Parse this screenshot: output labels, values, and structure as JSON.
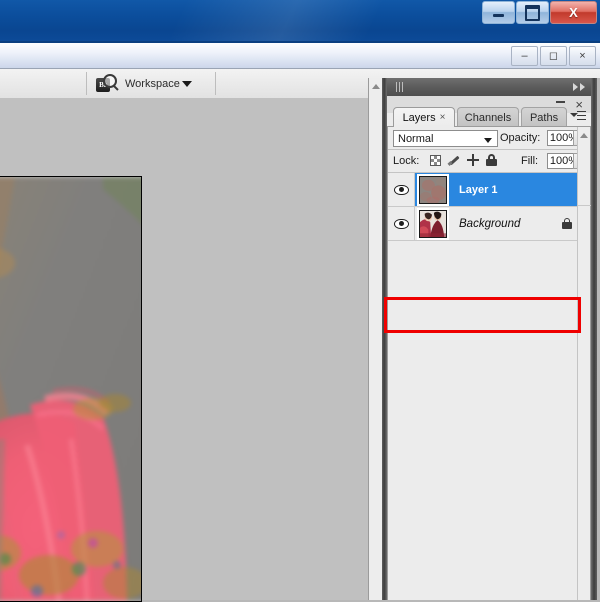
{
  "window": {
    "minimize_label": "–",
    "maximize_label": "❐",
    "close_label": "X"
  },
  "app_window": {
    "minimize_label": "–",
    "restore_label": "❐",
    "close_label": "×"
  },
  "options_bar": {
    "bridge_icon": "bridge-br-icon",
    "bridge_badge_text": "Br",
    "workspace_label": "Workspace",
    "workspace_caret": "chevron-down-icon"
  },
  "dock": {
    "grip": "drag-grip-icon",
    "expand_icon": "double-chevron-right-icon",
    "minimize_label": "–",
    "close_label": "×",
    "panel_menu_icon": "panel-menu-icon"
  },
  "panel": {
    "tabs": [
      {
        "label": "Layers",
        "active": true,
        "closable": true,
        "close_glyph": "×"
      },
      {
        "label": "Channels",
        "active": false,
        "closable": false,
        "close_glyph": ""
      },
      {
        "label": "Paths",
        "active": false,
        "closable": false,
        "close_glyph": ""
      }
    ],
    "blend_mode": {
      "value": "Normal",
      "caret": "chevron-down-icon"
    },
    "opacity": {
      "label": "Opacity:",
      "value": "100%",
      "spinner": "spinner-arrow-icon"
    },
    "fill": {
      "label": "Fill:",
      "value": "100%",
      "spinner": "spinner-arrow-icon"
    },
    "lock": {
      "label": "Lock:",
      "icons": [
        "lock-transparency-icon",
        "lock-image-brush-icon",
        "lock-position-move-icon",
        "lock-all-padlock-icon"
      ]
    },
    "layers": [
      {
        "name": "Layer 1",
        "visible": true,
        "selected": true,
        "locked": false,
        "italic": false,
        "eye_icon": "eye-visibility-icon",
        "thumbnail": "layer-thumbnail"
      },
      {
        "name": "Background",
        "visible": true,
        "selected": false,
        "locked": true,
        "italic": true,
        "eye_icon": "eye-visibility-icon",
        "thumbnail": "background-thumbnail",
        "lock_icon": "padlock-icon"
      }
    ]
  },
  "annotation": {
    "highlight_color": "#ef0000",
    "target": "Layer 1 row"
  },
  "colors": {
    "titlebar_blue": "#0b4d9b",
    "selection_blue": "#2a87e0",
    "panel_gray": "#ececec",
    "workspace_gray": "#c0c0c0",
    "dock_header": "#5a5a5a"
  },
  "canvas": {
    "description": "blurred photograph of a figure in a pink-red dress with gold ornamentation"
  }
}
